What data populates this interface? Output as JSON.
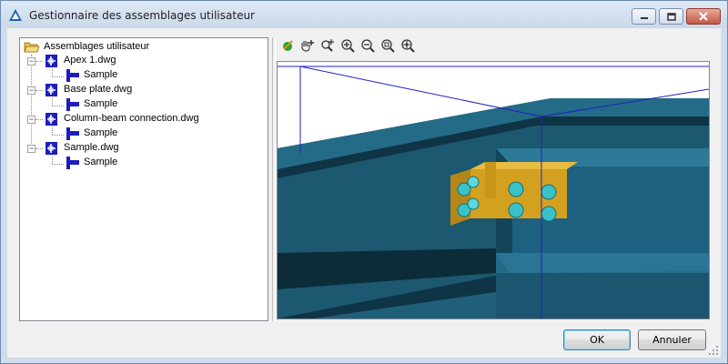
{
  "window": {
    "title": "Gestionnaire des assemblages utilisateur"
  },
  "tree": {
    "root": {
      "label": "Assemblages utilisateur",
      "icon": "open-folder-icon"
    },
    "files": [
      {
        "label": "Apex 1.dwg",
        "children": [
          {
            "label": "Sample"
          }
        ]
      },
      {
        "label": "Base plate.dwg",
        "children": [
          {
            "label": "Sample"
          }
        ]
      },
      {
        "label": "Column-beam connection.dwg",
        "children": [
          {
            "label": "Sample"
          }
        ]
      },
      {
        "label": "Sample.dwg",
        "children": [
          {
            "label": "Sample"
          }
        ]
      }
    ]
  },
  "toolbar": {
    "tools": [
      "render-style-icon",
      "pan-icon",
      "zoom-window-icon",
      "zoom-in-icon",
      "zoom-out-icon",
      "zoom-extents-icon",
      "zoom-realtime-icon"
    ]
  },
  "viewport": {
    "scene": "3D view of beam-to-column connection with fin plate and bolts",
    "colors": {
      "steel": "#1f5f78",
      "steel_dark": "#163f52",
      "plate": "#d4a020",
      "bolt": "#39c3c9",
      "bounding_lines": "#2020c0"
    }
  },
  "buttons": {
    "ok": "OK",
    "cancel": "Annuler"
  },
  "colors": {
    "accent": "#3c7fb1",
    "titlebar": "#cfdcec",
    "close": "#c45a45"
  }
}
